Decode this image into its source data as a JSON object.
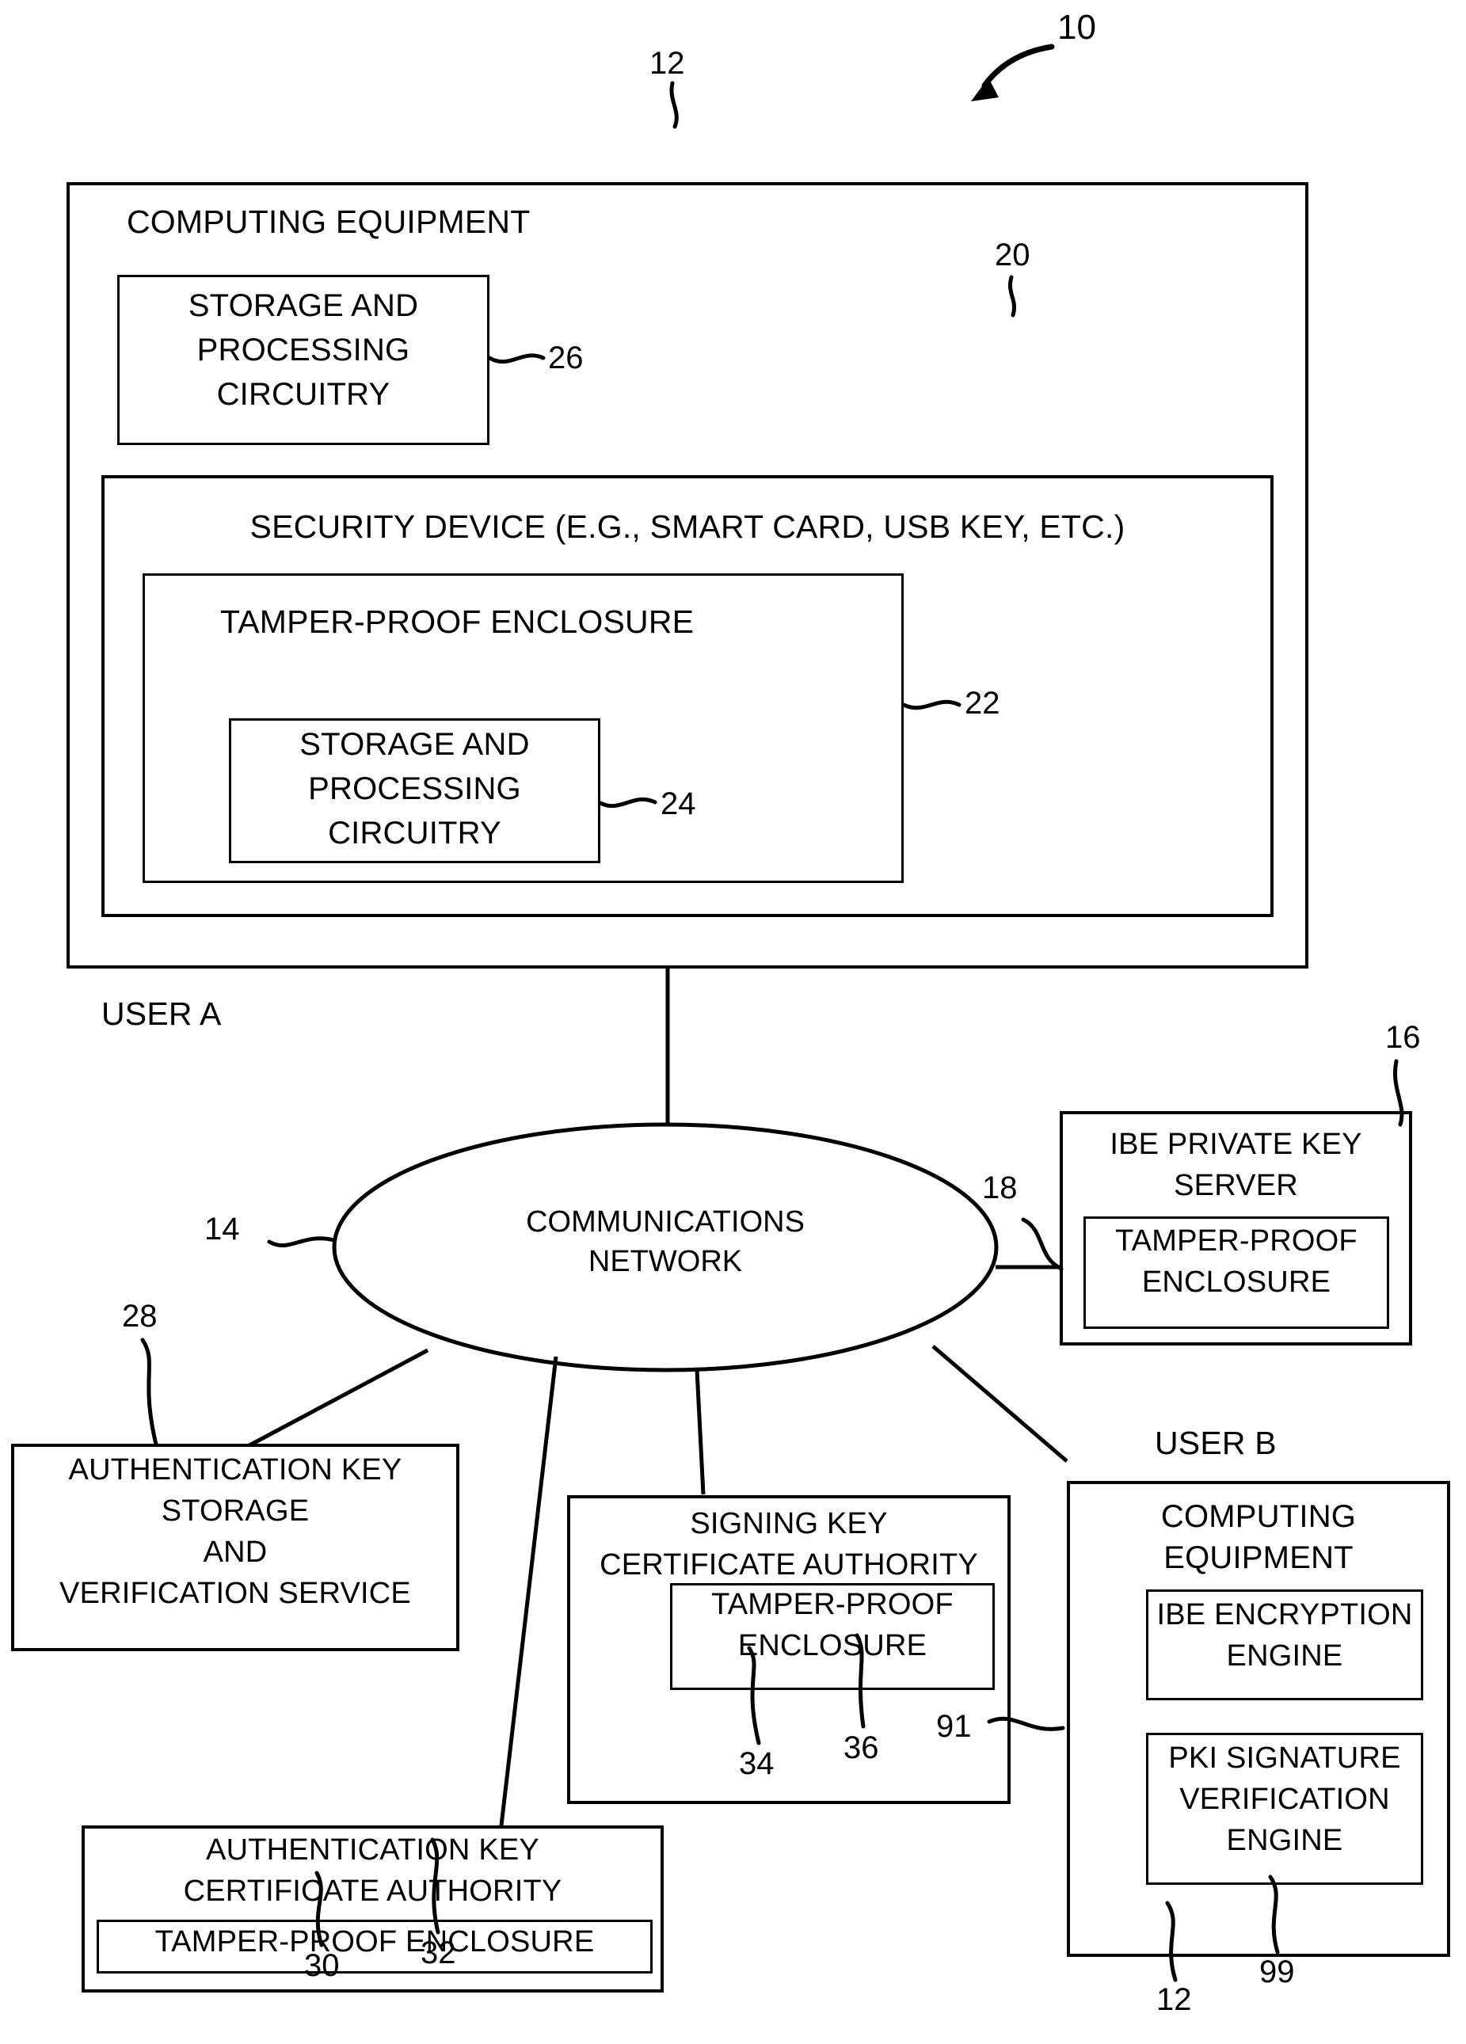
{
  "figure": {
    "system_ref": "10",
    "user_a_label": "USER A",
    "user_b_label": "USER B"
  },
  "user_a": {
    "computing_equipment": {
      "title": "COMPUTING EQUIPMENT",
      "ref": "12"
    },
    "storage_processing": {
      "line1": "STORAGE AND",
      "line2": "PROCESSING",
      "line3": "CIRCUITRY",
      "ref": "26"
    },
    "security_device": {
      "title": "SECURITY DEVICE (E.G., SMART CARD, USB KEY, ETC.)",
      "ref": "20"
    },
    "tamper_enclosure": {
      "title": "TAMPER-PROOF ENCLOSURE",
      "ref": "22"
    },
    "inner_storage_processing": {
      "line1": "STORAGE AND",
      "line2": "PROCESSING",
      "line3": "CIRCUITRY",
      "ref": "24"
    }
  },
  "network": {
    "line1": "COMMUNICATIONS",
    "line2": "NETWORK",
    "ref": "14"
  },
  "ibe_key_server": {
    "line1": "IBE PRIVATE KEY",
    "line2": "SERVER",
    "ref": "16",
    "enclosure": {
      "line1": "TAMPER-PROOF",
      "line2": "ENCLOSURE",
      "ref": "18"
    }
  },
  "auth_key_service": {
    "line1": "AUTHENTICATION KEY",
    "line2": "STORAGE",
    "line3": "AND",
    "line4": "VERIFICATION SERVICE",
    "ref": "28"
  },
  "auth_key_ca": {
    "line1": "AUTHENTICATION KEY",
    "line2": "CERTIFICATE AUTHORITY",
    "ref": "30",
    "enclosure": {
      "text": "TAMPER-PROOF ENCLOSURE",
      "ref": "32"
    }
  },
  "signing_key_ca": {
    "line1": "SIGNING KEY",
    "line2": "CERTIFICATE AUTHORITY",
    "ref": "34",
    "enclosure": {
      "line1": "TAMPER-PROOF",
      "line2": "ENCLOSURE",
      "ref": "36"
    }
  },
  "user_b": {
    "computing_equipment": {
      "line1": "COMPUTING",
      "line2": "EQUIPMENT",
      "ref": "12"
    },
    "ibe_encryption_engine": {
      "line1": "IBE ENCRYPTION",
      "line2": "ENGINE",
      "ref": "91"
    },
    "pki_signature_engine": {
      "line1": "PKI SIGNATURE",
      "line2": "VERIFICATION",
      "line3": "ENGINE",
      "ref": "99"
    }
  }
}
